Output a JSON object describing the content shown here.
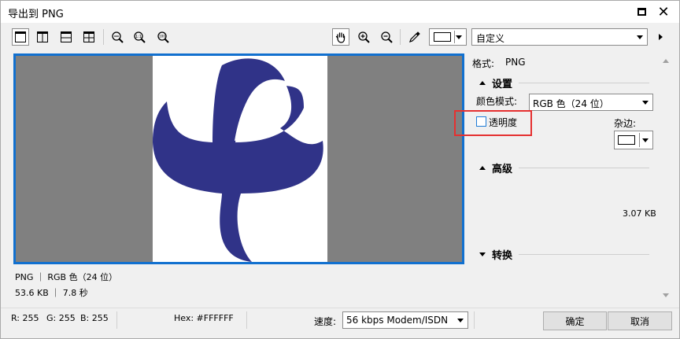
{
  "window": {
    "title": "导出到 PNG"
  },
  "toolbar": {
    "preset": "自定义",
    "icons": [
      "single-view-icon",
      "split-vertical-icon",
      "split-horizontal-icon",
      "quad-view-icon",
      "zoom-fit-icon",
      "zoom-1to1-icon",
      "zoom-100-icon",
      "pan-hand-icon",
      "zoom-in-icon",
      "zoom-out-icon",
      "eyedropper-icon"
    ]
  },
  "preview": {
    "background": "#808080",
    "logo_color": "#303388",
    "border_color": "#1170cf"
  },
  "status": {
    "line1": "PNG ｜ RGB 色（24 位）",
    "line2": "53.6 KB ｜ 7.8 秒"
  },
  "panel": {
    "format_label": "格式:",
    "format_value": "PNG",
    "settings_title": "设置",
    "color_mode_label": "颜色模式:",
    "color_mode_value": "RGB 色（24 位）",
    "transparency_label": "透明度",
    "transparency_checked": false,
    "matte_label": "杂边:",
    "advanced_title": "高级",
    "file_size": "3.07 KB",
    "transform_title": "转换"
  },
  "bottom": {
    "r": "R: 255",
    "g": "G: 255",
    "b": "B: 255",
    "hex": "Hex: #FFFFFF",
    "speed_label": "速度:",
    "speed_value": "56 kbps Modem/ISDN",
    "ok_label": "确定",
    "cancel_label": "取消"
  }
}
